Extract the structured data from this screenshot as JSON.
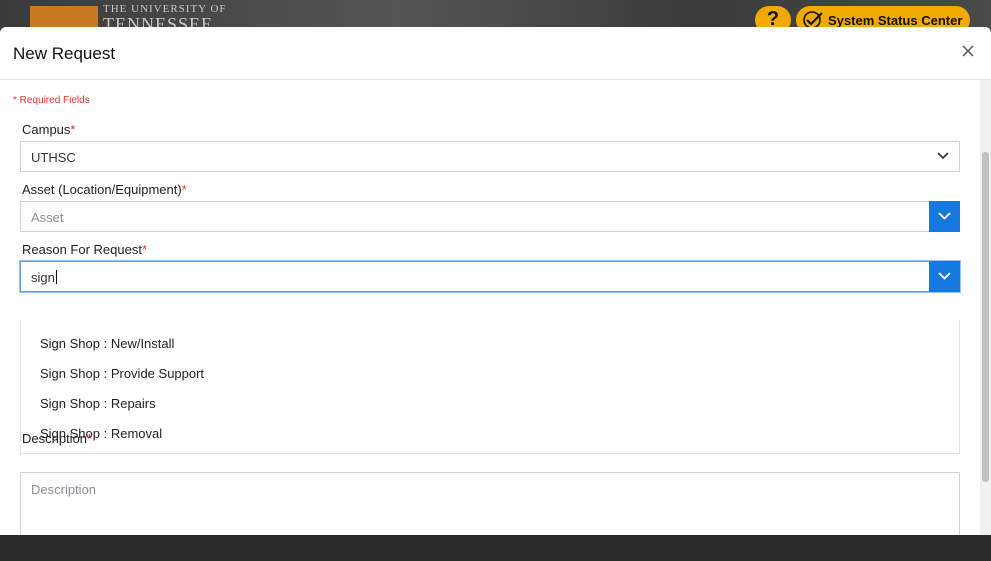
{
  "background": {
    "logo_line1": "THE UNIVERSITY OF",
    "logo_line2": "TENNESSEE",
    "help_label": "?",
    "status_center_label": "System Status Center"
  },
  "modal": {
    "title": "New Request",
    "required_note": "* Required Fields"
  },
  "fields": {
    "campus": {
      "label": "Campus",
      "value": "UTHSC"
    },
    "asset": {
      "label": "Asset (Location/Equipment)",
      "placeholder": "Asset"
    },
    "reason": {
      "label": "Reason For Request",
      "value": "sign"
    },
    "description": {
      "label": "Description",
      "placeholder": "Description"
    }
  },
  "required_mark": "*",
  "reason_options": [
    "Sign Shop : New/Install",
    "Sign Shop : Provide Support",
    "Sign Shop : Repairs",
    "Sign Shop : Removal"
  ],
  "colors": {
    "accent": "#1479dd",
    "required": "#e0332d",
    "brand_orange": "#f2a900"
  }
}
